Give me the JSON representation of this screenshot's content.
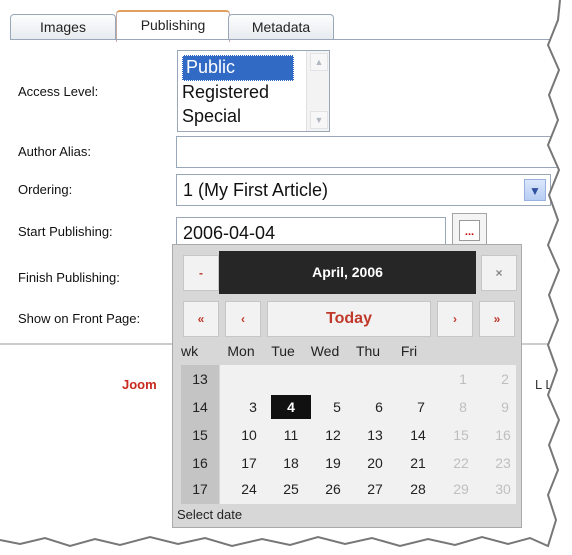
{
  "tabs": [
    {
      "label": "Images"
    },
    {
      "label": "Publishing"
    },
    {
      "label": "Metadata"
    }
  ],
  "form": {
    "access_level": {
      "label": "Access Level:",
      "options": [
        "Public",
        "Registered",
        "Special"
      ],
      "selected": "Public"
    },
    "author_alias": {
      "label": "Author Alias:",
      "value": ""
    },
    "ordering": {
      "label": "Ordering:",
      "value": "1 (My First Article)"
    },
    "start_publishing": {
      "label": "Start Publishing:",
      "value": "2006-04-04",
      "button": "..."
    },
    "finish_publishing": {
      "label": "Finish Publishing:"
    },
    "front_page": {
      "label": "Show on Front Page:"
    }
  },
  "background_text": {
    "left": "Joom",
    "right": "L Lic"
  },
  "calendar": {
    "close": "×",
    "help": "-",
    "month_title": "April, 2006",
    "nav": {
      "prev_year": "«",
      "prev_month": "‹",
      "today": "Today",
      "next_month": "›",
      "next_year": "»"
    },
    "week_header": "wk",
    "day_headers": [
      "Mon",
      "Tue",
      "Wed",
      "Thu",
      "Fri"
    ],
    "weeks": [
      {
        "wk": "13",
        "days": [
          "",
          "",
          "",
          "",
          "",
          "1",
          "2"
        ]
      },
      {
        "wk": "14",
        "days": [
          "3",
          "4",
          "5",
          "6",
          "7",
          "8",
          "9"
        ]
      },
      {
        "wk": "15",
        "days": [
          "10",
          "11",
          "12",
          "13",
          "14",
          "15",
          "16"
        ]
      },
      {
        "wk": "16",
        "days": [
          "17",
          "18",
          "19",
          "20",
          "21",
          "22",
          "23"
        ]
      },
      {
        "wk": "17",
        "days": [
          "24",
          "25",
          "26",
          "27",
          "28",
          "29",
          "30"
        ]
      }
    ],
    "selected_day": "4",
    "status": "Select date"
  },
  "colors": {
    "selected_option": "#316ac5",
    "accent_red": "#c8291d",
    "month_bar": "#262626"
  }
}
